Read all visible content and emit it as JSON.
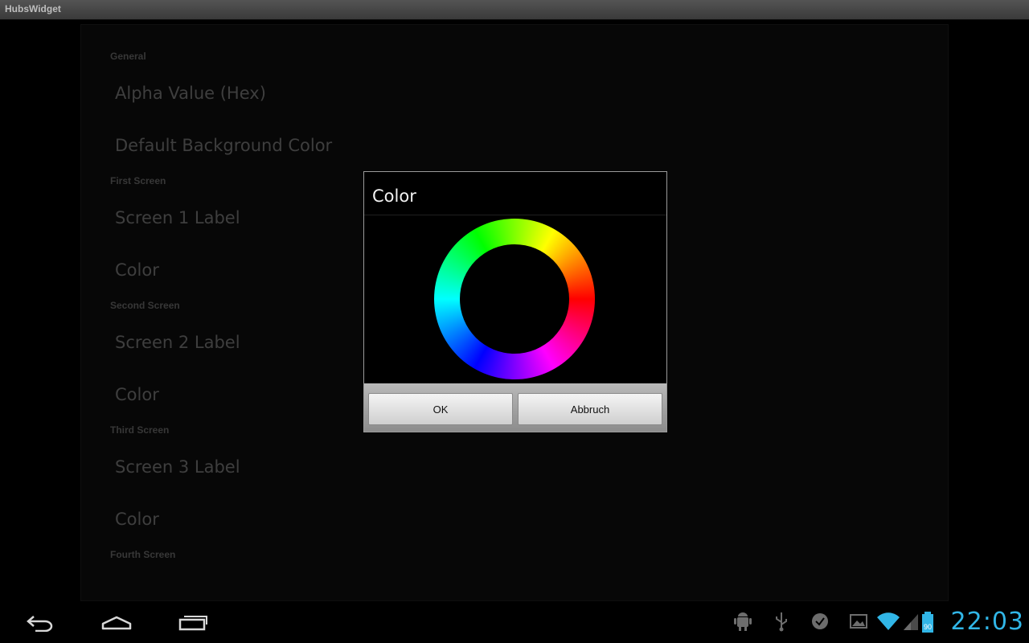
{
  "app": {
    "title": "HubsWidget"
  },
  "settings": {
    "categories": [
      {
        "label": "General"
      },
      {
        "label": "First Screen"
      },
      {
        "label": "Second Screen"
      },
      {
        "label": "Third Screen"
      },
      {
        "label": "Fourth Screen"
      }
    ],
    "items": [
      {
        "label": "Alpha Value (Hex)"
      },
      {
        "label": "Default Background Color"
      },
      {
        "label": "Screen 1 Label"
      },
      {
        "label": "Color"
      },
      {
        "label": "Screen 2 Label"
      },
      {
        "label": "Color"
      },
      {
        "label": "Screen 3 Label"
      },
      {
        "label": "Color"
      }
    ]
  },
  "dialog": {
    "title": "Color",
    "ok_label": "OK",
    "cancel_label": "Abbruch"
  },
  "navbar": {
    "icons": [
      "back-icon",
      "home-icon",
      "recent-apps-icon"
    ]
  },
  "status": {
    "icons": [
      "android-debug-icon",
      "usb-icon",
      "notification-icon",
      "image-icon",
      "wifi-icon",
      "signal-icon",
      "battery-icon"
    ],
    "battery": "90",
    "time": "22:03",
    "accent": "#31b6e7"
  }
}
